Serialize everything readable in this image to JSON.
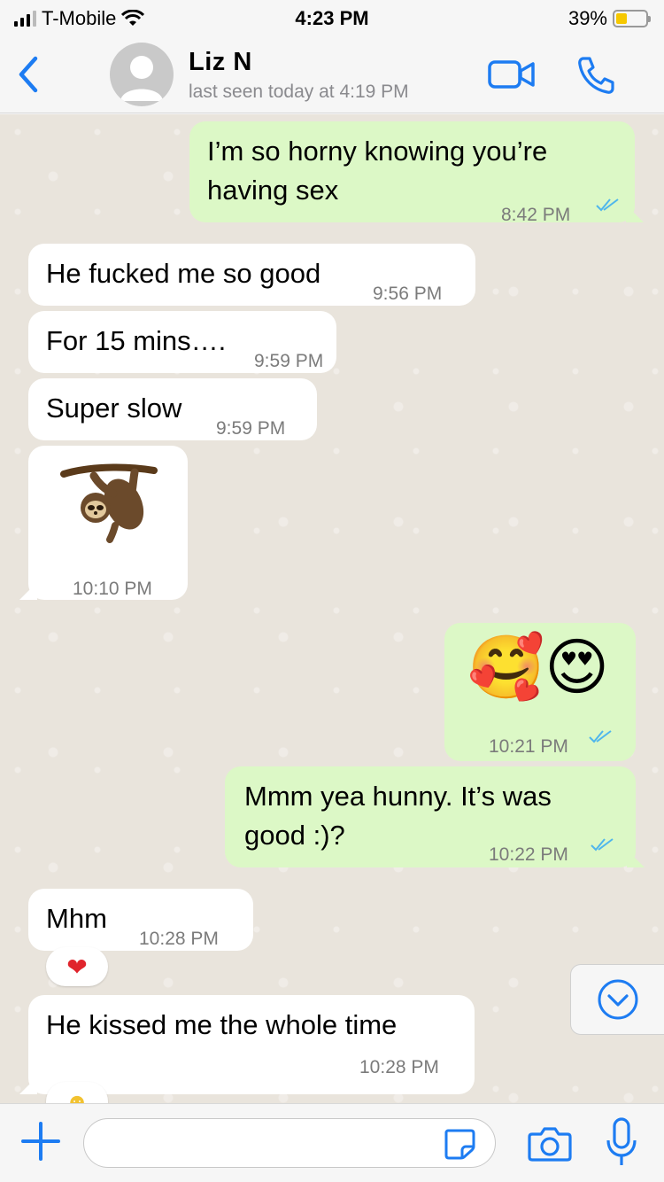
{
  "status_bar": {
    "carrier": "T-Mobile",
    "time": "4:23 PM",
    "battery": "39%"
  },
  "header": {
    "contact_name": "Liz  N",
    "last_seen": "last seen today at 4:19 PM"
  },
  "messages": [
    {
      "dir": "out",
      "lines": [
        "I’m so horny knowing you’re",
        "having sex"
      ],
      "time": "8:42 PM",
      "read": true
    },
    {
      "dir": "in",
      "text": "He fucked me so good",
      "time": "9:56 PM"
    },
    {
      "dir": "in",
      "text": "For 15 mins….",
      "time": "9:59 PM"
    },
    {
      "dir": "in",
      "text": "Super slow",
      "time": "9:59 PM"
    },
    {
      "dir": "in",
      "sticker": "sloth-sticker",
      "time": "10:10 PM"
    },
    {
      "dir": "out",
      "emoji": "🥰😍",
      "time": "10:21 PM",
      "read": true
    },
    {
      "dir": "out",
      "lines": [
        "Mmm yea hunny.  It’s was",
        "good :)?"
      ],
      "time": "10:22 PM",
      "read": true
    },
    {
      "dir": "in",
      "text": "Mhm",
      "time": "10:28 PM",
      "reaction": "❤"
    },
    {
      "dir": "in",
      "text": "He kissed me the whole time",
      "time": "10:28 PM"
    }
  ],
  "input": {
    "placeholder": ""
  },
  "colors": {
    "accent": "#1d7cf2",
    "outgoing_bubble": "#dcf8c6",
    "incoming_bubble": "#ffffff",
    "read_ticks": "#4fb6ec"
  }
}
